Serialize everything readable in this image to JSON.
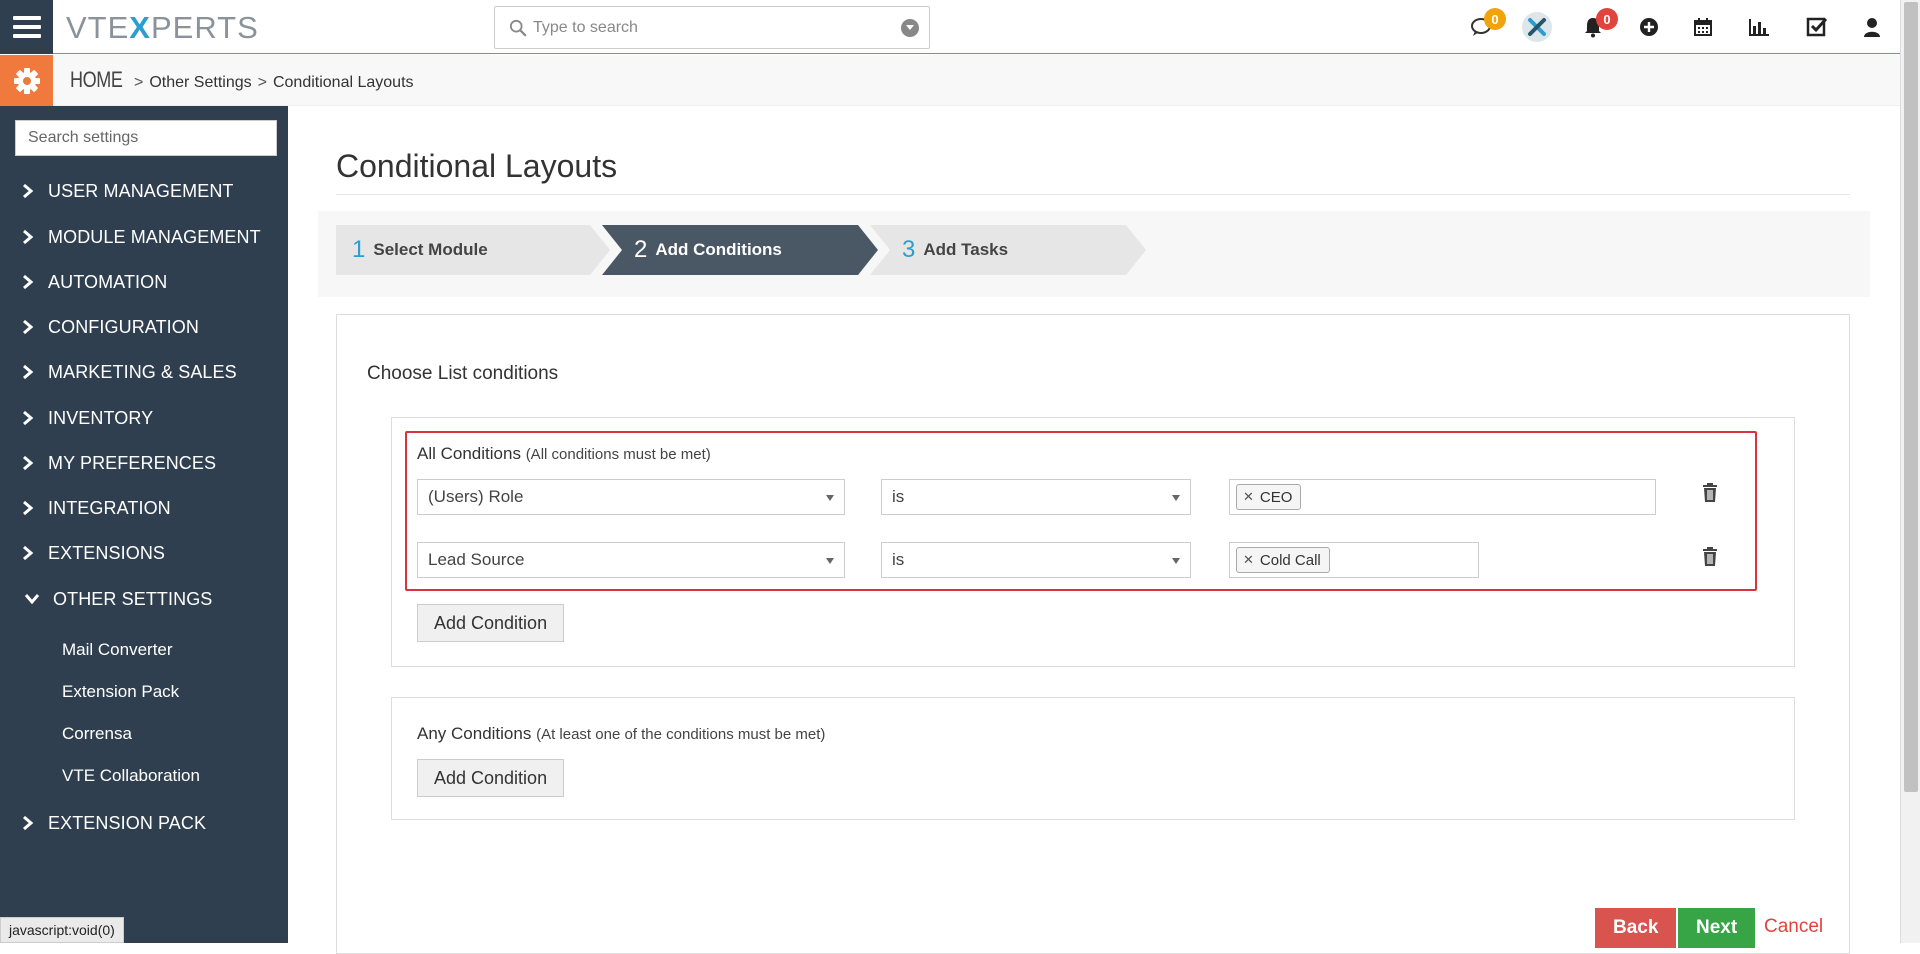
{
  "header": {
    "logo_left": "VTE",
    "logo_x": "X",
    "logo_right": "PERTS",
    "search_placeholder": "Type to search",
    "chat_badge": "0",
    "notif_badge": "0"
  },
  "breadcrumb": {
    "home": "HOME",
    "items": [
      "Other Settings",
      "Conditional Layouts"
    ],
    "separator": ">"
  },
  "sidebar": {
    "search_placeholder": "Search settings",
    "items": [
      {
        "label": "USER MANAGEMENT"
      },
      {
        "label": "MODULE MANAGEMENT"
      },
      {
        "label": "AUTOMATION"
      },
      {
        "label": "CONFIGURATION"
      },
      {
        "label": "MARKETING & SALES"
      },
      {
        "label": "INVENTORY"
      },
      {
        "label": "MY PREFERENCES"
      },
      {
        "label": "INTEGRATION"
      },
      {
        "label": "EXTENSIONS"
      },
      {
        "label": "OTHER SETTINGS",
        "expanded": true
      },
      {
        "label": "EXTENSION PACK"
      }
    ],
    "sub_items": [
      "Mail Converter",
      "Extension Pack",
      "Corrensa",
      "VTE Collaboration"
    ]
  },
  "status_tip": "javascript:void(0)",
  "main": {
    "title": "Conditional Layouts",
    "wizard": [
      {
        "num": "1",
        "label": "Select Module",
        "active": false
      },
      {
        "num": "2",
        "label": "Add Conditions",
        "active": true
      },
      {
        "num": "3",
        "label": "Add Tasks",
        "active": false
      }
    ],
    "panel_heading": "Choose List conditions",
    "all_conditions": {
      "title": "All Conditions",
      "hint": "(All conditions must be met)",
      "rows": [
        {
          "field": "(Users) Role",
          "operator": "is",
          "value": "CEO"
        },
        {
          "field": "Lead Source",
          "operator": "is",
          "value": "Cold Call"
        }
      ],
      "add_label": "Add Condition"
    },
    "any_conditions": {
      "title": "Any Conditions",
      "hint": "(At least one of the conditions must be met)",
      "add_label": "Add Condition"
    },
    "actions": {
      "back": "Back",
      "next": "Next",
      "cancel": "Cancel"
    }
  },
  "colors": {
    "sidebar_bg": "#2f3f4f",
    "accent_orange": "#f07a3e",
    "wizard_active": "#4a5866",
    "step_number": "#2b9ecf",
    "highlight_red": "#d9333f",
    "back_red": "#d9534f",
    "next_green": "#37a546"
  }
}
